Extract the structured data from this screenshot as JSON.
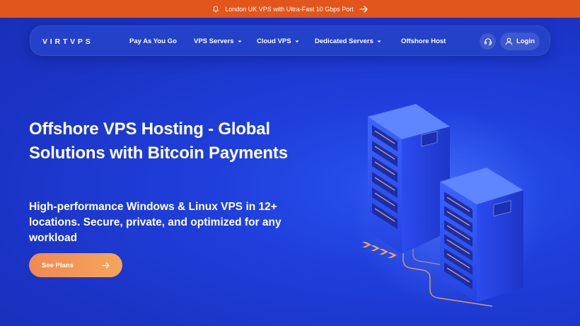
{
  "announcement": {
    "text": "London UK VPS with Ultra-Fast 10 Gbps Port",
    "icon": "bell-icon",
    "arrow_icon": "arrow-right-icon"
  },
  "nav": {
    "logo": "VIRTVPS",
    "items": [
      {
        "label": "Pay As You Go",
        "has_dropdown": false
      },
      {
        "label": "VPS Servers",
        "has_dropdown": true
      },
      {
        "label": "Cloud VPS",
        "has_dropdown": true
      },
      {
        "label": "Dedicated Servers",
        "has_dropdown": true
      },
      {
        "label": "Offshore Host",
        "has_dropdown": false
      }
    ],
    "support_icon": "headset-icon",
    "login_label": "Login",
    "login_icon": "user-icon"
  },
  "hero": {
    "title": "Offshore VPS Hosting - Global Solutions with Bitcoin Payments",
    "subtitle": "High-performance Windows & Linux VPS in 12+ locations. Secure, private, and optimized for any workload",
    "cta_label": "See Plans"
  },
  "colors": {
    "announcement_bg": "#e2561c",
    "hero_bg": "#1f3ad6",
    "cta_gradient_start": "#f08a52",
    "cta_gradient_end": "#f4a55c",
    "text": "#ffffff"
  }
}
